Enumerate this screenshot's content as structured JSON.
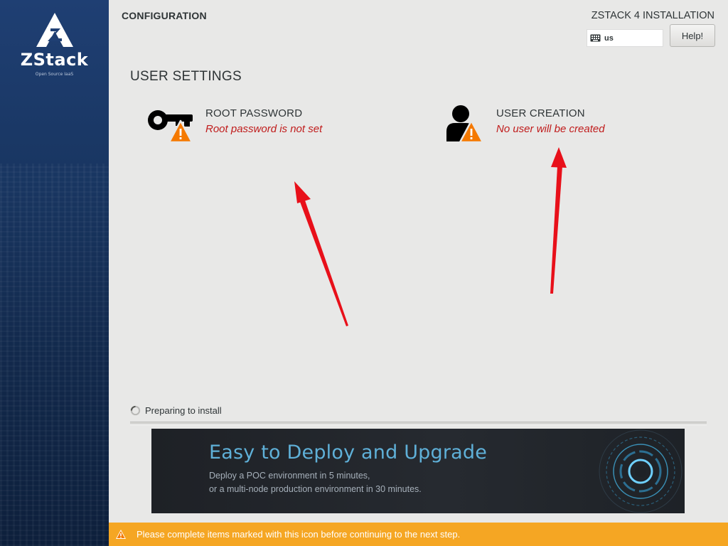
{
  "sidebar": {
    "logo_text": "ZStack",
    "logo_subtitle": "Open Source IaaS"
  },
  "header": {
    "title": "CONFIGURATION",
    "install_title": "ZSTACK 4 INSTALLATION",
    "keyboard_layout": "us",
    "help_label": "Help!"
  },
  "section": {
    "title": "USER SETTINGS"
  },
  "spokes": {
    "root": {
      "name": "ROOT PASSWORD",
      "status": "Root password is not set",
      "icon": "key-warning-icon"
    },
    "user": {
      "name": "USER CREATION",
      "status": "No user will be created",
      "icon": "user-warning-icon"
    }
  },
  "progress": {
    "label": "Preparing to install"
  },
  "banner": {
    "title": "Easy to Deploy and Upgrade",
    "line1": "Deploy a POC environment in 5 minutes,",
    "line2": "or a multi-node production environment in 30 minutes."
  },
  "footer": {
    "message": "Please complete items marked with this icon before continuing to the next step."
  },
  "colors": {
    "sidebar_top": "#1f3f73",
    "sidebar_bottom": "#0d1f3b",
    "warning": "#f57900",
    "footer_bg": "#f5a623",
    "status_red": "#c01c1c",
    "banner_title": "#5fb0d8",
    "annotation_arrow": "#e8101a"
  }
}
